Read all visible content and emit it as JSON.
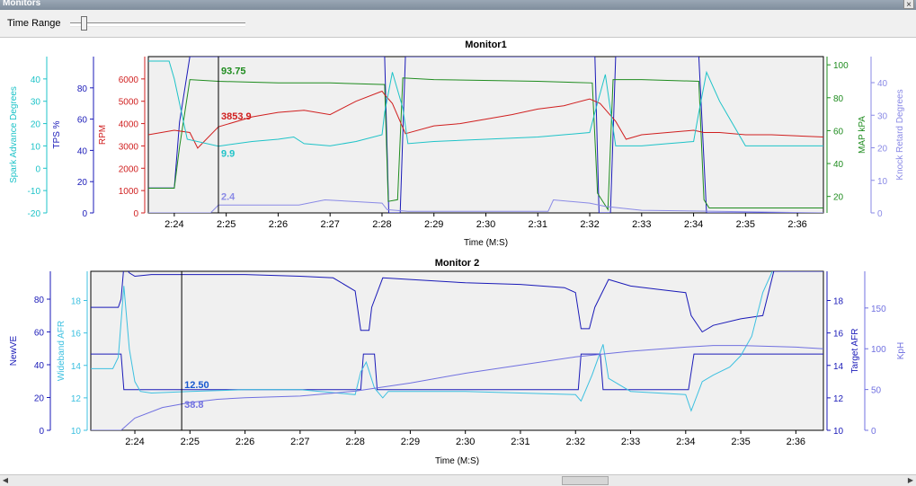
{
  "window": {
    "title": "Monitors",
    "close_glyph": "×"
  },
  "toolbar": {
    "time_range_label": "Time Range",
    "time_range_value": 0.05
  },
  "chart_data": [
    {
      "type": "line",
      "title": "Monitor1",
      "xlabel": "Time (M:S)",
      "xlim": [
        143.5,
        156.5
      ],
      "x_ticks": [
        "2:24",
        "2:25",
        "2:26",
        "2:27",
        "2:28",
        "2:29",
        "2:30",
        "2:31",
        "2:32",
        "2:33",
        "2:34",
        "2:35",
        "2:36"
      ],
      "x_tick_values": [
        144,
        145,
        146,
        147,
        148,
        149,
        150,
        151,
        152,
        153,
        154,
        155,
        156
      ],
      "cursor_time": 144.85,
      "axes": [
        {
          "key": "spark",
          "label": "Spark Advance Degrees",
          "side": "left",
          "color": "#1ec3c8",
          "min": -20,
          "max": 50,
          "ticks": [
            -20,
            -10,
            0,
            10,
            20,
            30,
            40
          ]
        },
        {
          "key": "tps",
          "label": "TPS %",
          "side": "left",
          "color": "#1a1ab8",
          "min": 0,
          "max": 100,
          "ticks": [
            0,
            20,
            40,
            60,
            80
          ]
        },
        {
          "key": "rpm",
          "label": "RPM",
          "side": "left",
          "color": "#d01f1f",
          "min": 0,
          "max": 7000,
          "ticks": [
            0,
            1000,
            2000,
            3000,
            4000,
            5000,
            6000
          ]
        },
        {
          "key": "map",
          "label": "MAP kPA",
          "side": "right",
          "color": "#1f8c1f",
          "min": 10,
          "max": 105,
          "ticks": [
            20,
            40,
            60,
            80,
            100
          ]
        },
        {
          "key": "knock",
          "label": "Knock Retard Degrees",
          "side": "right",
          "color": "#8a8ae6",
          "min": 0,
          "max": 48,
          "ticks": [
            0,
            10,
            20,
            30,
            40
          ]
        }
      ],
      "series": [
        {
          "axis": "tps",
          "color": "#1a1ab8",
          "x": [
            143.5,
            144.0,
            144.1,
            144.3,
            144.85,
            145.0,
            148.05,
            148.13,
            148.35,
            148.45,
            152.1,
            152.18,
            152.4,
            152.5,
            154.1,
            154.25,
            156.5
          ],
          "y": [
            16,
            16,
            58,
            100,
            100,
            100,
            100,
            0,
            0,
            100,
            100,
            0,
            0,
            100,
            100,
            0,
            0
          ]
        },
        {
          "axis": "map",
          "color": "#1f8c1f",
          "x": [
            143.5,
            144.0,
            144.1,
            144.3,
            144.85,
            146.0,
            147.0,
            148.05,
            148.12,
            148.3,
            148.4,
            149.0,
            151.0,
            152.05,
            152.15,
            152.35,
            152.45,
            153.0,
            154.1,
            154.2,
            154.3,
            156.5
          ],
          "y": [
            25,
            25,
            50,
            91,
            90,
            89,
            89,
            88,
            17,
            18,
            92,
            91,
            90,
            89,
            22,
            12,
            91,
            91,
            90,
            18,
            13,
            13
          ]
        },
        {
          "axis": "rpm",
          "color": "#d01f1f",
          "x": [
            143.5,
            144.0,
            144.3,
            144.45,
            144.85,
            145.5,
            146.0,
            146.5,
            147.0,
            147.5,
            148.0,
            148.05,
            148.2,
            148.45,
            149.0,
            149.5,
            150.0,
            150.5,
            151.0,
            151.5,
            152.0,
            152.2,
            152.5,
            152.7,
            153.0,
            153.5,
            154.0,
            154.2,
            154.5,
            155.0,
            155.5,
            156.5
          ],
          "y": [
            3500,
            3700,
            3600,
            2900,
            3854,
            4300,
            4500,
            4600,
            4400,
            5000,
            5450,
            5300,
            4900,
            3550,
            3900,
            4000,
            4200,
            4400,
            4650,
            4800,
            5100,
            4900,
            4100,
            3300,
            3500,
            3600,
            3700,
            3600,
            3600,
            3500,
            3500,
            3400
          ]
        },
        {
          "axis": "spark",
          "color": "#1ec3c8",
          "x": [
            143.5,
            143.9,
            144.0,
            144.25,
            144.85,
            145.5,
            146.0,
            146.3,
            146.5,
            147.0,
            147.5,
            148.0,
            148.05,
            148.2,
            148.4,
            148.5,
            149.0,
            150.0,
            151.0,
            152.0,
            152.1,
            152.3,
            152.5,
            153.0,
            153.5,
            154.0,
            154.1,
            154.25,
            154.5,
            155.0,
            156.5
          ],
          "y": [
            48,
            48,
            40,
            13,
            9.9,
            12,
            13,
            14,
            11,
            10,
            12,
            15,
            25,
            43,
            27,
            11,
            12,
            13,
            14,
            16,
            25,
            42,
            10,
            10,
            11,
            12,
            25,
            43,
            30,
            10,
            10
          ]
        },
        {
          "axis": "knock",
          "color": "#8a8ae6",
          "x": [
            143.5,
            144.7,
            144.85,
            146.4,
            146.9,
            148.0,
            148.1,
            148.5,
            151.2,
            151.3,
            152.0,
            152.3,
            153.0,
            156.5
          ],
          "y": [
            0,
            0,
            2.4,
            2.4,
            4,
            3,
            1,
            0.5,
            0.5,
            4,
            3,
            2,
            0.8,
            0
          ]
        }
      ],
      "labels": [
        {
          "text": "93.75",
          "color": "#1f8c1f"
        },
        {
          "text": "3853.9",
          "color": "#d01f1f"
        },
        {
          "text": "9.9",
          "color": "#1ec3c8"
        },
        {
          "text": "2.4",
          "color": "#8a8ae6"
        }
      ]
    },
    {
      "type": "line",
      "title": "Monitor 2",
      "xlabel": "Time (M:S)",
      "xlim": [
        143.2,
        156.5
      ],
      "x_ticks": [
        "2:24",
        "2:25",
        "2:26",
        "2:27",
        "2:28",
        "2:29",
        "2:30",
        "2:31",
        "2:32",
        "2:33",
        "2:34",
        "2:35",
        "2:36"
      ],
      "x_tick_values": [
        144,
        145,
        146,
        147,
        148,
        149,
        150,
        151,
        152,
        153,
        154,
        155,
        156
      ],
      "cursor_time": 144.85,
      "axes": [
        {
          "key": "newve",
          "label": "NewVE",
          "side": "left",
          "color": "#1a1ab8",
          "min": 0,
          "max": 97,
          "ticks": [
            0,
            20,
            40,
            60,
            80
          ]
        },
        {
          "key": "wbafr",
          "label": "Wideband AFR",
          "side": "left",
          "color": "#3cc0e0",
          "min": 10,
          "max": 19.8,
          "ticks": [
            10,
            12,
            14,
            16,
            18
          ]
        },
        {
          "key": "tafr",
          "label": "Target AFR",
          "side": "right",
          "color": "#1a1ab8",
          "min": 10,
          "max": 19.8,
          "ticks": [
            10,
            12,
            14,
            16,
            18
          ]
        },
        {
          "key": "kph",
          "label": "KpH",
          "side": "right",
          "color": "#7070e0",
          "min": 0,
          "max": 195,
          "ticks": [
            0,
            50,
            100,
            150
          ]
        }
      ],
      "series": [
        {
          "axis": "newve",
          "color": "#1a1ab8",
          "x": [
            143.2,
            143.7,
            143.75,
            143.8,
            143.9,
            144.0,
            144.3,
            145.0,
            146.0,
            147.0,
            147.6,
            148.0,
            148.1,
            148.25,
            148.3,
            148.5,
            149.0,
            150.0,
            151.0,
            151.8,
            152.0,
            152.1,
            152.25,
            152.35,
            152.6,
            153.0,
            153.5,
            154.0,
            154.1,
            154.3,
            154.5,
            155.0,
            155.4,
            155.6,
            156.5
          ],
          "y": [
            75,
            75,
            80,
            100,
            96,
            94,
            95,
            95,
            95,
            94,
            93,
            85,
            61,
            61,
            75,
            93,
            92,
            90,
            89,
            87,
            84,
            62,
            62,
            75,
            92,
            88,
            86,
            84,
            70,
            60,
            64,
            68,
            70,
            97,
            97
          ]
        },
        {
          "axis": "tafr",
          "color": "#1a1ab8",
          "x": [
            143.2,
            143.75,
            143.8,
            148.1,
            148.15,
            148.35,
            148.4,
            152.05,
            152.1,
            152.45,
            152.5,
            154.05,
            154.15,
            156.5
          ],
          "y": [
            14.7,
            14.7,
            12.5,
            12.5,
            14.7,
            14.7,
            12.5,
            12.5,
            14.7,
            14.7,
            12.5,
            12.5,
            14.7,
            14.7
          ]
        },
        {
          "axis": "wbafr",
          "color": "#3cc0e0",
          "x": [
            143.2,
            143.6,
            143.7,
            143.8,
            143.9,
            144.0,
            144.1,
            144.3,
            145.0,
            146.0,
            147.0,
            148.0,
            148.1,
            148.2,
            148.35,
            148.5,
            148.6,
            149.0,
            150.0,
            151.0,
            152.0,
            152.1,
            152.3,
            152.5,
            152.6,
            153.0,
            153.5,
            154.0,
            154.1,
            154.3,
            154.5,
            154.8,
            155.0,
            155.2,
            155.4,
            155.6,
            156.5
          ],
          "y": [
            13.8,
            13.8,
            14.5,
            18.9,
            15,
            13,
            12.4,
            12.3,
            12.4,
            12.5,
            12.5,
            12.2,
            13.6,
            14.2,
            12.6,
            12,
            12.4,
            12.4,
            12.4,
            12.3,
            12.2,
            11.8,
            13.4,
            15.3,
            13.2,
            12.4,
            12.3,
            12.2,
            11.2,
            13,
            13.4,
            13.9,
            14.6,
            15.8,
            18.5,
            20,
            20
          ]
        },
        {
          "axis": "kph",
          "color": "#7070e0",
          "x": [
            143.2,
            143.75,
            144.0,
            144.5,
            145.0,
            145.5,
            146.0,
            147.0,
            148.0,
            149.0,
            150.0,
            151.0,
            152.0,
            153.0,
            154.0,
            154.5,
            155.0,
            156.0,
            156.5
          ],
          "y": [
            0,
            0,
            15,
            28,
            34,
            38,
            40,
            42,
            48,
            58,
            70,
            80,
            90,
            97,
            102,
            104,
            104,
            102,
            100
          ]
        }
      ],
      "labels": [
        {
          "text": "12.50",
          "color": "#1a5ad0"
        },
        {
          "text": "38.8",
          "color": "#7070e0"
        }
      ]
    }
  ],
  "scrollbar": {
    "left_glyph": "◀",
    "right_glyph": "▶"
  }
}
